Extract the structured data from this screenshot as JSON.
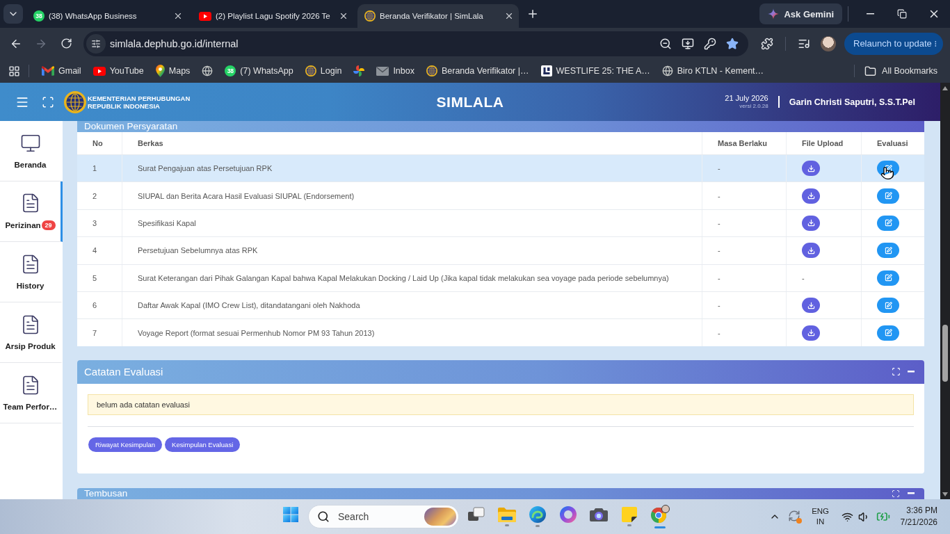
{
  "browser": {
    "tabs": [
      {
        "title": "(38) WhatsApp Business",
        "kind": "whatsapp",
        "badge": "38",
        "selected": false
      },
      {
        "title": "(2) Playlist Lagu Spotify 2026 Te",
        "kind": "youtube",
        "selected": false
      },
      {
        "title": "Beranda Verifikator | SimLala",
        "kind": "emblem",
        "selected": true
      }
    ],
    "ask_button": "Ask Gemini",
    "url": "simlala.dephub.go.id/internal",
    "forward_disabled": true,
    "bookmarked": true,
    "relaunch_button": "Relaunch to update",
    "bookmarks": [
      {
        "label": "Gmail",
        "kind": "gmail"
      },
      {
        "label": "YouTube",
        "kind": "youtube"
      },
      {
        "label": "Maps",
        "kind": "maps"
      },
      {
        "kind": "globe"
      },
      {
        "label": "(7) WhatsApp",
        "kind": "whatsapp",
        "badge": "38"
      },
      {
        "label": "Login",
        "kind": "emblem"
      },
      {
        "kind": "pinwheel"
      },
      {
        "label": "Inbox",
        "kind": "mail"
      },
      {
        "label": "Beranda Verifikator |…",
        "kind": "emblem"
      },
      {
        "label": "WESTLIFE 25: THE A…",
        "kind": "square-logo"
      },
      {
        "label": "Biro KTLN - Kement…",
        "kind": "globe"
      }
    ],
    "all_bookmarks": "All Bookmarks"
  },
  "header": {
    "org_name": [
      "KEMENTERIAN PERHUBUNGAN",
      "REPUBLIK INDONESIA"
    ],
    "title": "SIMLALA",
    "date": "21 July 2026",
    "version": "versi 2.0.28",
    "user": "Garin Christi Saputri, S.S.T.Pel"
  },
  "sidebar": {
    "items": [
      {
        "label": "Beranda",
        "kind": "monitor",
        "selected": false
      },
      {
        "label": "Perizinan",
        "kind": "document",
        "badge": "29",
        "selected": true
      },
      {
        "label": "History",
        "kind": "document",
        "selected": false
      },
      {
        "label": "Arsip Produk",
        "kind": "document",
        "selected": false
      },
      {
        "label": "Team Perfor…",
        "kind": "document",
        "selected": false
      }
    ]
  },
  "documents": {
    "title": "Dokumen Persyaratan",
    "columns": [
      "No",
      "Berkas",
      "Masa Berlaku",
      "File Upload",
      "Evaluasi"
    ],
    "rows": [
      {
        "no": "1",
        "document": "Surat Pengajuan atas Persetujuan RPK",
        "validity": "-",
        "file_upload": {
          "kind": "download"
        },
        "evaluation": {
          "kind": "edit"
        },
        "hovered": true
      },
      {
        "no": "2",
        "document": "SIUPAL dan Berita Acara Hasil Evaluasi SIUPAL (Endorsement)",
        "validity": "-",
        "file_upload": {
          "kind": "download"
        },
        "evaluation": {
          "kind": "edit"
        },
        "hovered": false
      },
      {
        "no": "3",
        "document": "Spesifikasi Kapal",
        "validity": "-",
        "file_upload": {
          "kind": "download"
        },
        "evaluation": {
          "kind": "edit"
        },
        "hovered": false
      },
      {
        "no": "4",
        "document": "Persetujuan Sebelumnya atas RPK",
        "validity": "-",
        "file_upload": {
          "kind": "download"
        },
        "evaluation": {
          "kind": "edit"
        },
        "hovered": false
      },
      {
        "no": "5",
        "document": "Surat Keterangan dari Pihak Galangan Kapal bahwa Kapal Melakukan Docking / Laid Up (Jika kapal tidak melakukan sea voyage pada periode sebelumnya)",
        "validity": "-",
        "file_upload": {
          "kind": "text",
          "text": "-"
        },
        "evaluation": {
          "kind": "edit"
        },
        "hovered": false
      },
      {
        "no": "6",
        "document": "Daftar Awak Kapal (IMO Crew List), ditandatangani oleh Nakhoda",
        "validity": "-",
        "file_upload": {
          "kind": "download"
        },
        "evaluation": {
          "kind": "edit"
        },
        "hovered": false
      },
      {
        "no": "7",
        "document": "Voyage Report (format sesuai Permenhub Nomor PM 93 Tahun 2013)",
        "validity": "-",
        "file_upload": {
          "kind": "download"
        },
        "evaluation": {
          "kind": "edit"
        },
        "hovered": false
      }
    ]
  },
  "evaluation_notes": {
    "title": "Catatan Evaluasi",
    "message": "belum ada catatan evaluasi",
    "buttons": [
      "Riwayat Kesimpulan",
      "Kesimpulan Evaluasi"
    ]
  },
  "next_card": {
    "title": "Tembusan"
  },
  "taskbar": {
    "search": {
      "placeholder": "Search"
    },
    "apps": [
      {
        "kind": "task-view",
        "running": false,
        "selected": false
      },
      {
        "kind": "explorer",
        "running": true,
        "selected": false
      },
      {
        "kind": "edge",
        "running": true,
        "selected": false
      },
      {
        "kind": "copilot",
        "running": false,
        "selected": false
      },
      {
        "kind": "camera",
        "running": false,
        "selected": false
      },
      {
        "kind": "sticky-notes",
        "running": true,
        "selected": false
      },
      {
        "kind": "chrome",
        "running": true,
        "selected": true
      }
    ],
    "language": [
      "ENG",
      "IN"
    ],
    "time": "3:36 PM",
    "date": "7/21/2026"
  }
}
